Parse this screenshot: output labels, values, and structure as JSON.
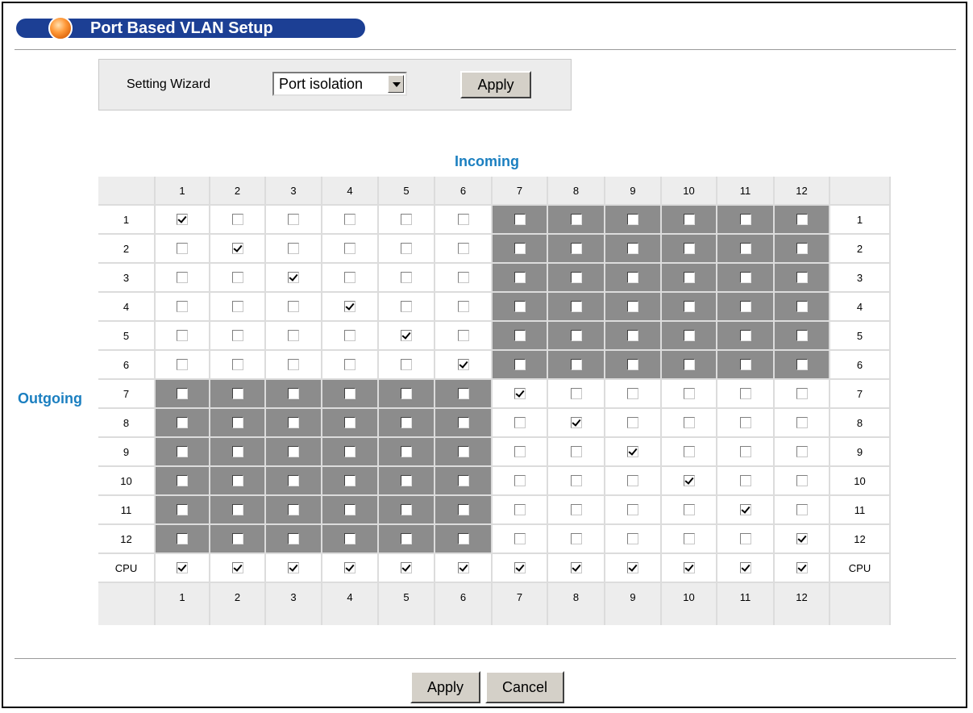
{
  "title": "Port Based VLAN Setup",
  "wizard": {
    "label": "Setting Wizard",
    "selected": "Port isolation",
    "apply_label": "Apply"
  },
  "matrix": {
    "incoming_label": "Incoming",
    "outgoing_label": "Outgoing",
    "columns": [
      "1",
      "2",
      "3",
      "4",
      "5",
      "6",
      "7",
      "8",
      "9",
      "10",
      "11",
      "12"
    ],
    "rows": [
      "1",
      "2",
      "3",
      "4",
      "5",
      "6",
      "7",
      "8",
      "9",
      "10",
      "11",
      "12",
      "CPU"
    ],
    "checked": [
      [
        1,
        0,
        0,
        0,
        0,
        0,
        0,
        0,
        0,
        0,
        0,
        0
      ],
      [
        0,
        1,
        0,
        0,
        0,
        0,
        0,
        0,
        0,
        0,
        0,
        0
      ],
      [
        0,
        0,
        1,
        0,
        0,
        0,
        0,
        0,
        0,
        0,
        0,
        0
      ],
      [
        0,
        0,
        0,
        1,
        0,
        0,
        0,
        0,
        0,
        0,
        0,
        0
      ],
      [
        0,
        0,
        0,
        0,
        1,
        0,
        0,
        0,
        0,
        0,
        0,
        0
      ],
      [
        0,
        0,
        0,
        0,
        0,
        1,
        0,
        0,
        0,
        0,
        0,
        0
      ],
      [
        0,
        0,
        0,
        0,
        0,
        0,
        1,
        0,
        0,
        0,
        0,
        0
      ],
      [
        0,
        0,
        0,
        0,
        0,
        0,
        0,
        1,
        0,
        0,
        0,
        0
      ],
      [
        0,
        0,
        0,
        0,
        0,
        0,
        0,
        0,
        1,
        0,
        0,
        0
      ],
      [
        0,
        0,
        0,
        0,
        0,
        0,
        0,
        0,
        0,
        1,
        0,
        0
      ],
      [
        0,
        0,
        0,
        0,
        0,
        0,
        0,
        0,
        0,
        0,
        1,
        0
      ],
      [
        0,
        0,
        0,
        0,
        0,
        0,
        0,
        0,
        0,
        0,
        0,
        1
      ],
      [
        1,
        1,
        1,
        1,
        1,
        1,
        1,
        1,
        1,
        1,
        1,
        1
      ]
    ],
    "shaded": [
      [
        0,
        0,
        0,
        0,
        0,
        0,
        1,
        1,
        1,
        1,
        1,
        1
      ],
      [
        0,
        0,
        0,
        0,
        0,
        0,
        1,
        1,
        1,
        1,
        1,
        1
      ],
      [
        0,
        0,
        0,
        0,
        0,
        0,
        1,
        1,
        1,
        1,
        1,
        1
      ],
      [
        0,
        0,
        0,
        0,
        0,
        0,
        1,
        1,
        1,
        1,
        1,
        1
      ],
      [
        0,
        0,
        0,
        0,
        0,
        0,
        1,
        1,
        1,
        1,
        1,
        1
      ],
      [
        0,
        0,
        0,
        0,
        0,
        0,
        1,
        1,
        1,
        1,
        1,
        1
      ],
      [
        1,
        1,
        1,
        1,
        1,
        1,
        0,
        0,
        0,
        0,
        0,
        0
      ],
      [
        1,
        1,
        1,
        1,
        1,
        1,
        0,
        0,
        0,
        0,
        0,
        0
      ],
      [
        1,
        1,
        1,
        1,
        1,
        1,
        0,
        0,
        0,
        0,
        0,
        0
      ],
      [
        1,
        1,
        1,
        1,
        1,
        1,
        0,
        0,
        0,
        0,
        0,
        0
      ],
      [
        1,
        1,
        1,
        1,
        1,
        1,
        0,
        0,
        0,
        0,
        0,
        0
      ],
      [
        1,
        1,
        1,
        1,
        1,
        1,
        0,
        0,
        0,
        0,
        0,
        0
      ],
      [
        0,
        0,
        0,
        0,
        0,
        0,
        0,
        0,
        0,
        0,
        0,
        0
      ]
    ]
  },
  "footer": {
    "apply_label": "Apply",
    "cancel_label": "Cancel"
  }
}
